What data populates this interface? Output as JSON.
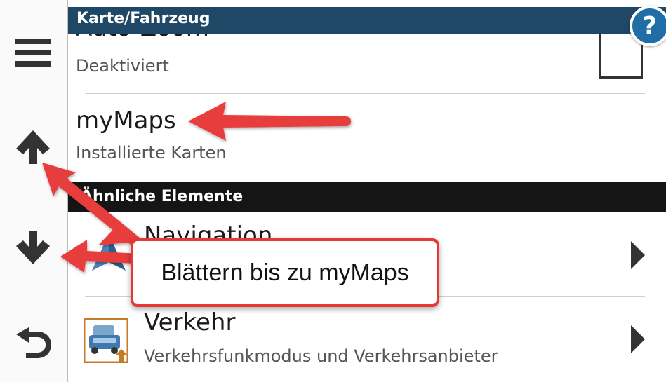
{
  "header": {
    "title": "Karte/Fahrzeug",
    "help_label": "?"
  },
  "sidebar": {
    "items": [
      {
        "name": "menu-button",
        "icon": "hamburger-menu-icon"
      },
      {
        "name": "scroll-up-button",
        "icon": "arrow-up-icon"
      },
      {
        "name": "scroll-down-button",
        "icon": "arrow-down-icon"
      },
      {
        "name": "back-button",
        "icon": "back-icon"
      }
    ]
  },
  "items": {
    "autozoom": {
      "title": "Auto-Zoom",
      "subtitle": "Deaktiviert",
      "checked": false
    },
    "mymaps": {
      "title": "myMaps",
      "subtitle": "Installierte Karten"
    }
  },
  "section": {
    "title": "Ähnliche Elemente"
  },
  "related": [
    {
      "title": "Navigation",
      "icon": "navigation-icon"
    },
    {
      "title": "Verkehr",
      "subtitle": "Verkehrsfunkmodus und Verkehrsanbieter",
      "icon": "traffic-icon"
    }
  ],
  "callout": {
    "text": "Blättern bis zu myMaps"
  },
  "colors": {
    "header": "#1f4866",
    "accent": "#e53935",
    "help": "#1f6fa6"
  }
}
